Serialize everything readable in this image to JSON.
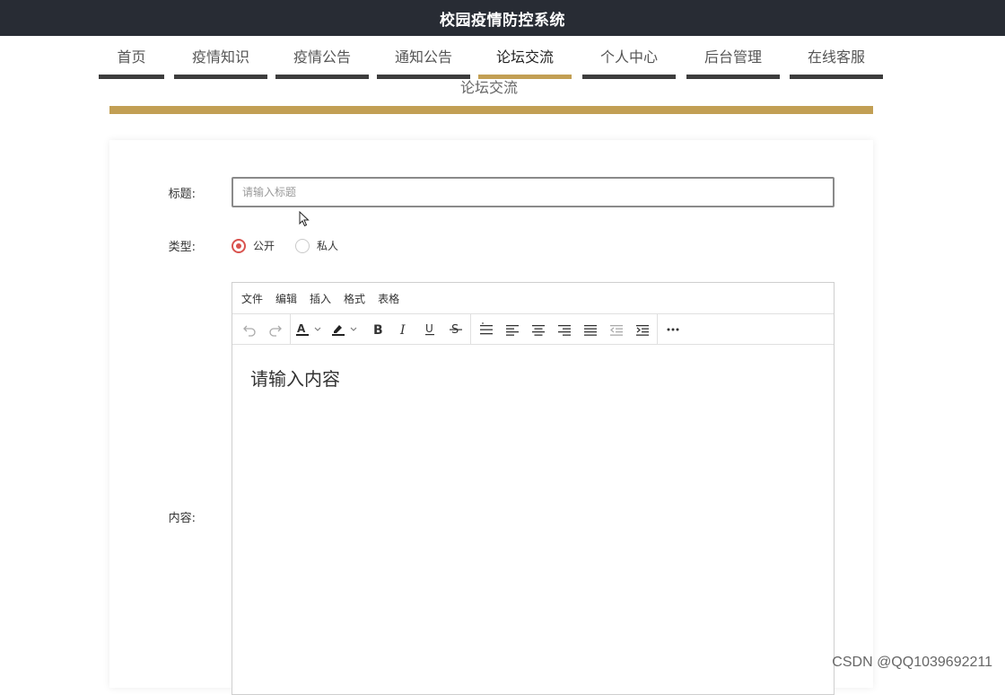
{
  "app": {
    "title": "校园疫情防控系统"
  },
  "nav": {
    "items": [
      {
        "label": "首页"
      },
      {
        "label": "疫情知识"
      },
      {
        "label": "疫情公告"
      },
      {
        "label": "通知公告"
      },
      {
        "label": "论坛交流",
        "active": true
      },
      {
        "label": "个人中心"
      },
      {
        "label": "后台管理"
      },
      {
        "label": "在线客服"
      }
    ]
  },
  "page": {
    "subtitle": "论坛交流"
  },
  "form": {
    "title_label": "标题:",
    "title_placeholder": "请输入标题",
    "title_value": "",
    "type_label": "类型:",
    "type_options": [
      {
        "label": "公开",
        "checked": true
      },
      {
        "label": "私人",
        "checked": false
      }
    ],
    "content_label": "内容:"
  },
  "editor": {
    "menu": [
      "文件",
      "编辑",
      "插入",
      "格式",
      "表格"
    ],
    "placeholder": "请输入内容",
    "toolbar_icons": [
      "undo-icon",
      "redo-icon",
      "text-color-icon",
      "highlight-icon",
      "bold-icon",
      "italic-icon",
      "underline-icon",
      "strikethrough-icon",
      "line-height-icon",
      "align-left-icon",
      "align-center-icon",
      "align-right-icon",
      "align-justify-icon",
      "outdent-icon",
      "indent-icon",
      "more-icon"
    ]
  },
  "watermark": "CSDN @QQ1039692211",
  "colors": {
    "accent": "#c29f54",
    "topbar": "#282c34",
    "radio": "#d9534f"
  }
}
